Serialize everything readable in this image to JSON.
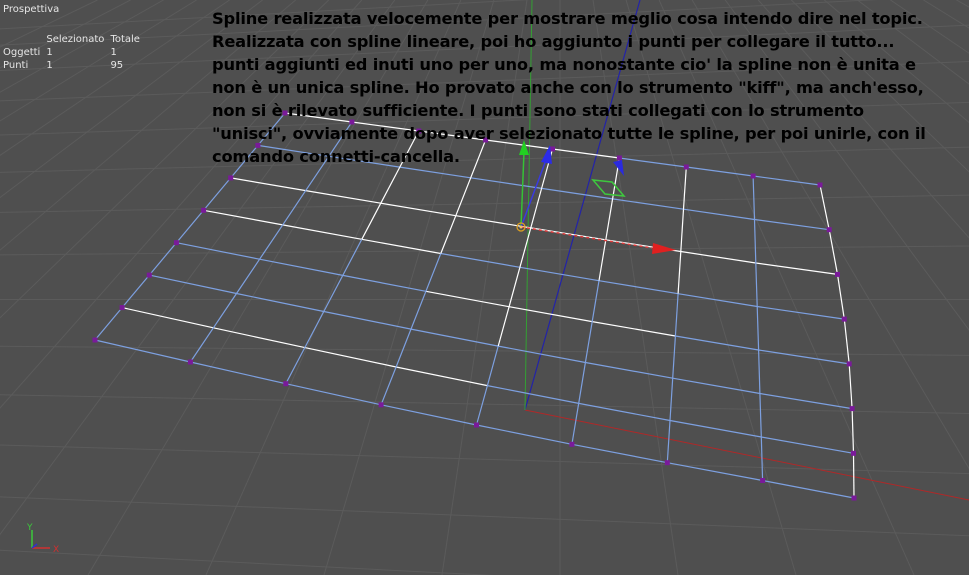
{
  "viewport": {
    "label": "Prospettiva"
  },
  "stats": {
    "col_selected": "Selezionato",
    "col_total": "Totale",
    "rows": [
      {
        "label": "Oggetti",
        "selected": "1",
        "total": "1"
      },
      {
        "label": "Punti",
        "selected": "1",
        "total": "95"
      }
    ]
  },
  "note": {
    "lines": [
      "Spline realizzata velocemente per mostrare meglio cosa intendo dire nel topic.",
      "Realizzata con spline lineare, poi ho aggiunto i punti per collegare il tutto...",
      "punti aggiunti ed inuti uno per uno, ma nonostante cio' la spline non è unita e",
      "non è un unica spline. Ho provato anche con lo strumento \"kiff\", ma anch'esso,",
      "non si è rilevato sufficiente. I punti sono stati collegati con lo strumento",
      "\"unisci\", ovviamente dopo aver selezionato tutte le spline, per poi unirle, con il",
      "comando connetti-cancella."
    ]
  },
  "axis_widget": {
    "y_label": "Y",
    "x_label": "X"
  },
  "colors": {
    "background": "#4f4f4f",
    "grid": "#5b5b5b",
    "spline_selected": "#ffffff",
    "spline": "#7da0e0",
    "point": "#7a1a9a",
    "axis_x": "#c83232",
    "axis_y": "#3cc83c",
    "axis_z": "#2a2ad0"
  }
}
